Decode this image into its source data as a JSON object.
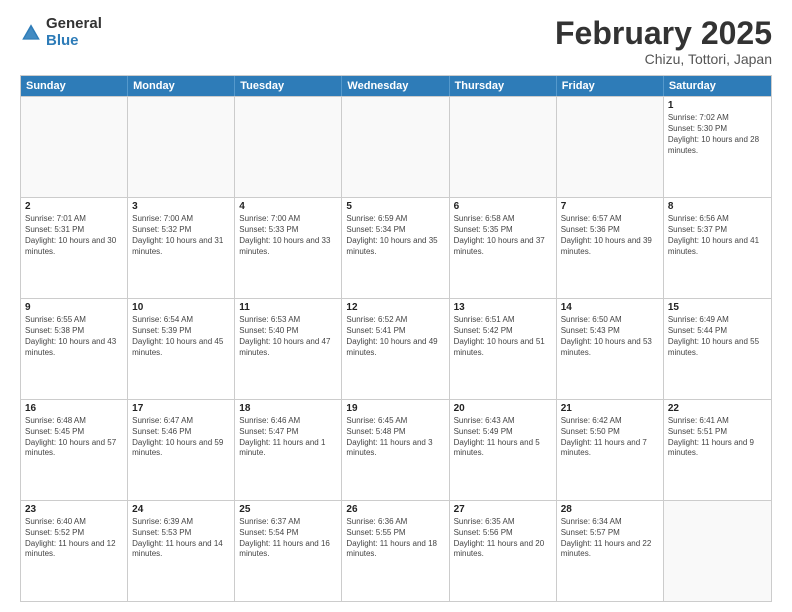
{
  "logo": {
    "general": "General",
    "blue": "Blue"
  },
  "title": "February 2025",
  "subtitle": "Chizu, Tottori, Japan",
  "header_days": [
    "Sunday",
    "Monday",
    "Tuesday",
    "Wednesday",
    "Thursday",
    "Friday",
    "Saturday"
  ],
  "rows": [
    [
      {
        "day": "",
        "info": ""
      },
      {
        "day": "",
        "info": ""
      },
      {
        "day": "",
        "info": ""
      },
      {
        "day": "",
        "info": ""
      },
      {
        "day": "",
        "info": ""
      },
      {
        "day": "",
        "info": ""
      },
      {
        "day": "1",
        "info": "Sunrise: 7:02 AM\nSunset: 5:30 PM\nDaylight: 10 hours and 28 minutes."
      }
    ],
    [
      {
        "day": "2",
        "info": "Sunrise: 7:01 AM\nSunset: 5:31 PM\nDaylight: 10 hours and 30 minutes."
      },
      {
        "day": "3",
        "info": "Sunrise: 7:00 AM\nSunset: 5:32 PM\nDaylight: 10 hours and 31 minutes."
      },
      {
        "day": "4",
        "info": "Sunrise: 7:00 AM\nSunset: 5:33 PM\nDaylight: 10 hours and 33 minutes."
      },
      {
        "day": "5",
        "info": "Sunrise: 6:59 AM\nSunset: 5:34 PM\nDaylight: 10 hours and 35 minutes."
      },
      {
        "day": "6",
        "info": "Sunrise: 6:58 AM\nSunset: 5:35 PM\nDaylight: 10 hours and 37 minutes."
      },
      {
        "day": "7",
        "info": "Sunrise: 6:57 AM\nSunset: 5:36 PM\nDaylight: 10 hours and 39 minutes."
      },
      {
        "day": "8",
        "info": "Sunrise: 6:56 AM\nSunset: 5:37 PM\nDaylight: 10 hours and 41 minutes."
      }
    ],
    [
      {
        "day": "9",
        "info": "Sunrise: 6:55 AM\nSunset: 5:38 PM\nDaylight: 10 hours and 43 minutes."
      },
      {
        "day": "10",
        "info": "Sunrise: 6:54 AM\nSunset: 5:39 PM\nDaylight: 10 hours and 45 minutes."
      },
      {
        "day": "11",
        "info": "Sunrise: 6:53 AM\nSunset: 5:40 PM\nDaylight: 10 hours and 47 minutes."
      },
      {
        "day": "12",
        "info": "Sunrise: 6:52 AM\nSunset: 5:41 PM\nDaylight: 10 hours and 49 minutes."
      },
      {
        "day": "13",
        "info": "Sunrise: 6:51 AM\nSunset: 5:42 PM\nDaylight: 10 hours and 51 minutes."
      },
      {
        "day": "14",
        "info": "Sunrise: 6:50 AM\nSunset: 5:43 PM\nDaylight: 10 hours and 53 minutes."
      },
      {
        "day": "15",
        "info": "Sunrise: 6:49 AM\nSunset: 5:44 PM\nDaylight: 10 hours and 55 minutes."
      }
    ],
    [
      {
        "day": "16",
        "info": "Sunrise: 6:48 AM\nSunset: 5:45 PM\nDaylight: 10 hours and 57 minutes."
      },
      {
        "day": "17",
        "info": "Sunrise: 6:47 AM\nSunset: 5:46 PM\nDaylight: 10 hours and 59 minutes."
      },
      {
        "day": "18",
        "info": "Sunrise: 6:46 AM\nSunset: 5:47 PM\nDaylight: 11 hours and 1 minute."
      },
      {
        "day": "19",
        "info": "Sunrise: 6:45 AM\nSunset: 5:48 PM\nDaylight: 11 hours and 3 minutes."
      },
      {
        "day": "20",
        "info": "Sunrise: 6:43 AM\nSunset: 5:49 PM\nDaylight: 11 hours and 5 minutes."
      },
      {
        "day": "21",
        "info": "Sunrise: 6:42 AM\nSunset: 5:50 PM\nDaylight: 11 hours and 7 minutes."
      },
      {
        "day": "22",
        "info": "Sunrise: 6:41 AM\nSunset: 5:51 PM\nDaylight: 11 hours and 9 minutes."
      }
    ],
    [
      {
        "day": "23",
        "info": "Sunrise: 6:40 AM\nSunset: 5:52 PM\nDaylight: 11 hours and 12 minutes."
      },
      {
        "day": "24",
        "info": "Sunrise: 6:39 AM\nSunset: 5:53 PM\nDaylight: 11 hours and 14 minutes."
      },
      {
        "day": "25",
        "info": "Sunrise: 6:37 AM\nSunset: 5:54 PM\nDaylight: 11 hours and 16 minutes."
      },
      {
        "day": "26",
        "info": "Sunrise: 6:36 AM\nSunset: 5:55 PM\nDaylight: 11 hours and 18 minutes."
      },
      {
        "day": "27",
        "info": "Sunrise: 6:35 AM\nSunset: 5:56 PM\nDaylight: 11 hours and 20 minutes."
      },
      {
        "day": "28",
        "info": "Sunrise: 6:34 AM\nSunset: 5:57 PM\nDaylight: 11 hours and 22 minutes."
      },
      {
        "day": "",
        "info": ""
      }
    ]
  ]
}
